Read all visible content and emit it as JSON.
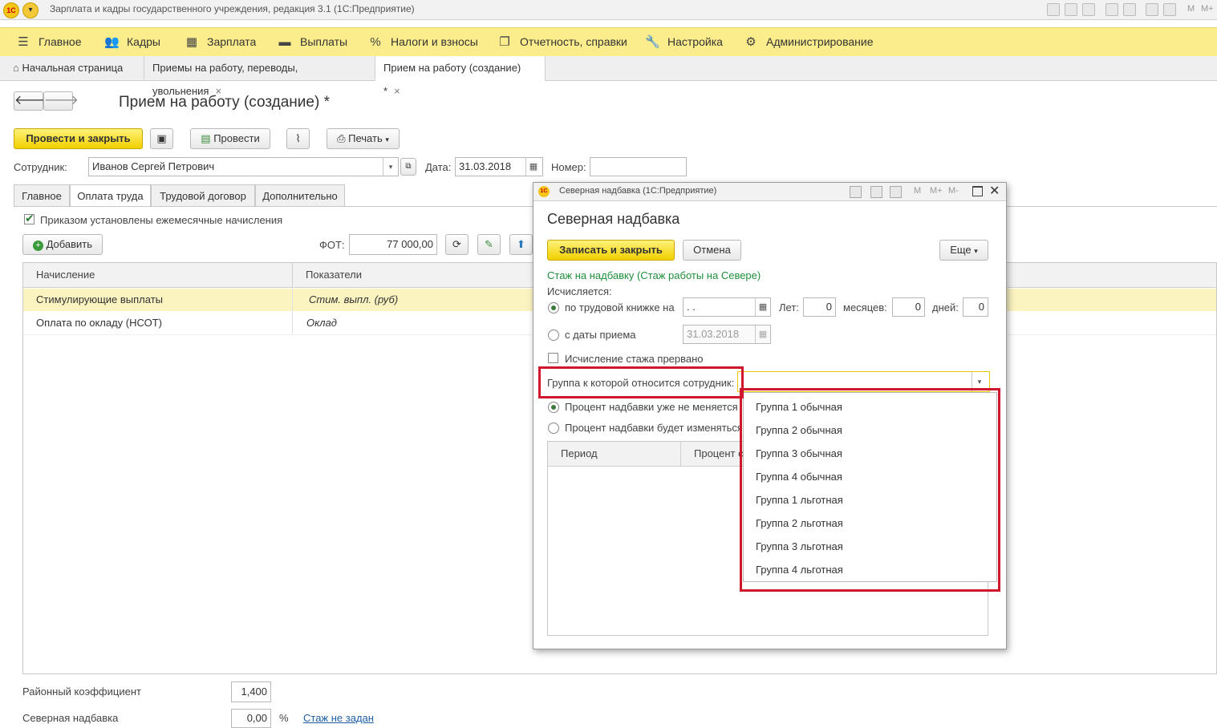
{
  "window": {
    "title": "Зарплата и кадры государственного учреждения, редакция 3.1  (1С:Предприятие)",
    "logo_text": "1С",
    "right_icons": [
      "M",
      "M+",
      "M-"
    ]
  },
  "main_menu": {
    "items": [
      {
        "label": "Главное",
        "icon": "☰"
      },
      {
        "label": "Кадры",
        "icon": "👥"
      },
      {
        "label": "Зарплата",
        "icon": "▦"
      },
      {
        "label": "Выплаты",
        "icon": "▬"
      },
      {
        "label": "Налоги и взносы",
        "icon": "%"
      },
      {
        "label": "Отчетность, справки",
        "icon": "❐"
      },
      {
        "label": "Настройка",
        "icon": "🔧"
      },
      {
        "label": "Администрирование",
        "icon": "⚙"
      }
    ]
  },
  "tabs": {
    "home": "Начальная страница",
    "tab1": "Приемы на работу, переводы, увольнения",
    "tab2": "Прием на работу (создание) *",
    "close": "×"
  },
  "form": {
    "title": "Прием на работу (создание) *",
    "post_close": "Провести и закрыть",
    "post": "Провести",
    "print": "Печать",
    "employee_label": "Сотрудник:",
    "employee_value": "Иванов Сергей Петрович",
    "date_label": "Дата:",
    "date_value": "31.03.2018",
    "number_label": "Номер:",
    "number_value": "",
    "tabs": [
      "Главное",
      "Оплата труда",
      "Трудовой договор",
      "Дополнительно"
    ],
    "checkbox_label": "Приказом установлены ежемесячные начисления",
    "add_button": "Добавить",
    "fot_label": "ФОТ:",
    "fot_value": "77 000,00",
    "table": {
      "headers": [
        "Начисление",
        "Показатели"
      ],
      "rows": [
        {
          "name": "Стимулирующие выплаты",
          "indicator": "Стим. выпл. (руб)"
        },
        {
          "name": "Оплата по окладу (НСОТ)",
          "indicator": "Оклад"
        }
      ]
    },
    "district_label": "Районный коэффициент",
    "district_value": "1,400",
    "north_label": "Северная надбавка",
    "north_value": "0,00",
    "percent": "%",
    "north_link": "Стаж не задан"
  },
  "dialog": {
    "window_title": "Северная надбавка  (1С:Предприятие)",
    "heading": "Северная надбавка",
    "save_close": "Записать и закрыть",
    "cancel": "Отмена",
    "more": "Еще",
    "link": "Стаж на надбавку (Стаж работы на Севере)",
    "calc_label": "Исчисляется:",
    "radio1": "по трудовой книжке на",
    "radio1_date": " .  .",
    "years_label": "Лет:",
    "years": "0",
    "months_label": "месяцев:",
    "months": "0",
    "days_label": "дней:",
    "days": "0",
    "radio2": "с даты приема",
    "radio2_date": "31.03.2018",
    "interrupted": "Исчисление стажа прервано",
    "group_label": "Группа к которой относится сотрудник:",
    "group_value": "",
    "pct_radio1": "Процент надбавки уже не меняется",
    "pct_radio2": "Процент надбавки будет изменяться",
    "table_headers": [
      "Период",
      "Процент с"
    ],
    "options": [
      "Группа 1 обычная",
      "Группа 2 обычная",
      "Группа 3 обычная",
      "Группа 4 обычная",
      "Группа 1 льготная",
      "Группа 2 льготная",
      "Группа 3 льготная",
      "Группа 4 льготная"
    ]
  },
  "colors": {
    "accent_yellow": "#f1d000",
    "menu_bg": "#fbec8c",
    "highlight_red": "#d0182c",
    "link_green": "#1f8f3a"
  }
}
